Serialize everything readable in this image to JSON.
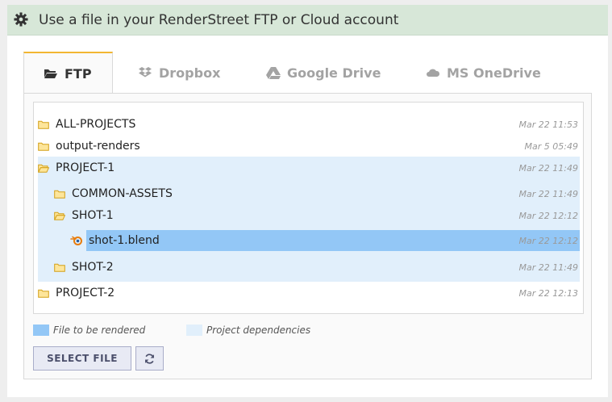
{
  "header": {
    "title": "Use a file in your RenderStreet FTP or Cloud account",
    "icon": "gear-icon"
  },
  "tabs": [
    {
      "label": "FTP",
      "icon": "folder-open-icon",
      "active": true
    },
    {
      "label": "Dropbox",
      "icon": "dropbox-icon",
      "active": false
    },
    {
      "label": "Google Drive",
      "icon": "google-drive-icon",
      "active": false
    },
    {
      "label": "MS OneDrive",
      "icon": "onedrive-icon",
      "active": false
    }
  ],
  "tree": {
    "rows": [
      {
        "name": "ALL-PROJECTS",
        "date": "Mar 22 11:53",
        "type": "folder"
      },
      {
        "name": "output-renders",
        "date": "Mar 5 05:49",
        "type": "folder"
      },
      {
        "name": "PROJECT-1",
        "date": "Mar 22 11:49",
        "type": "folder-open"
      },
      {
        "name": "COMMON-ASSETS",
        "date": "Mar 22 11:49",
        "type": "folder"
      },
      {
        "name": "SHOT-1",
        "date": "Mar 22 12:12",
        "type": "folder-open"
      },
      {
        "name": "shot-1.blend",
        "date": "Mar 22 12:12",
        "type": "blend-file"
      },
      {
        "name": "SHOT-2",
        "date": "Mar 22 11:49",
        "type": "folder"
      },
      {
        "name": "PROJECT-2",
        "date": "Mar 22 12:13",
        "type": "folder"
      }
    ]
  },
  "legend": [
    {
      "label": "File to be rendered",
      "color": "#93c7f6"
    },
    {
      "label": "Project dependencies",
      "color": "#e1effb"
    }
  ],
  "buttons": {
    "select_label": "SELECT FILE",
    "refresh_icon": "refresh-icon"
  },
  "colors": {
    "header_bg": "#d7e7d8",
    "tab_accent": "#f2b632",
    "folder": "#f0c24f",
    "blend": "#e87d0d"
  }
}
